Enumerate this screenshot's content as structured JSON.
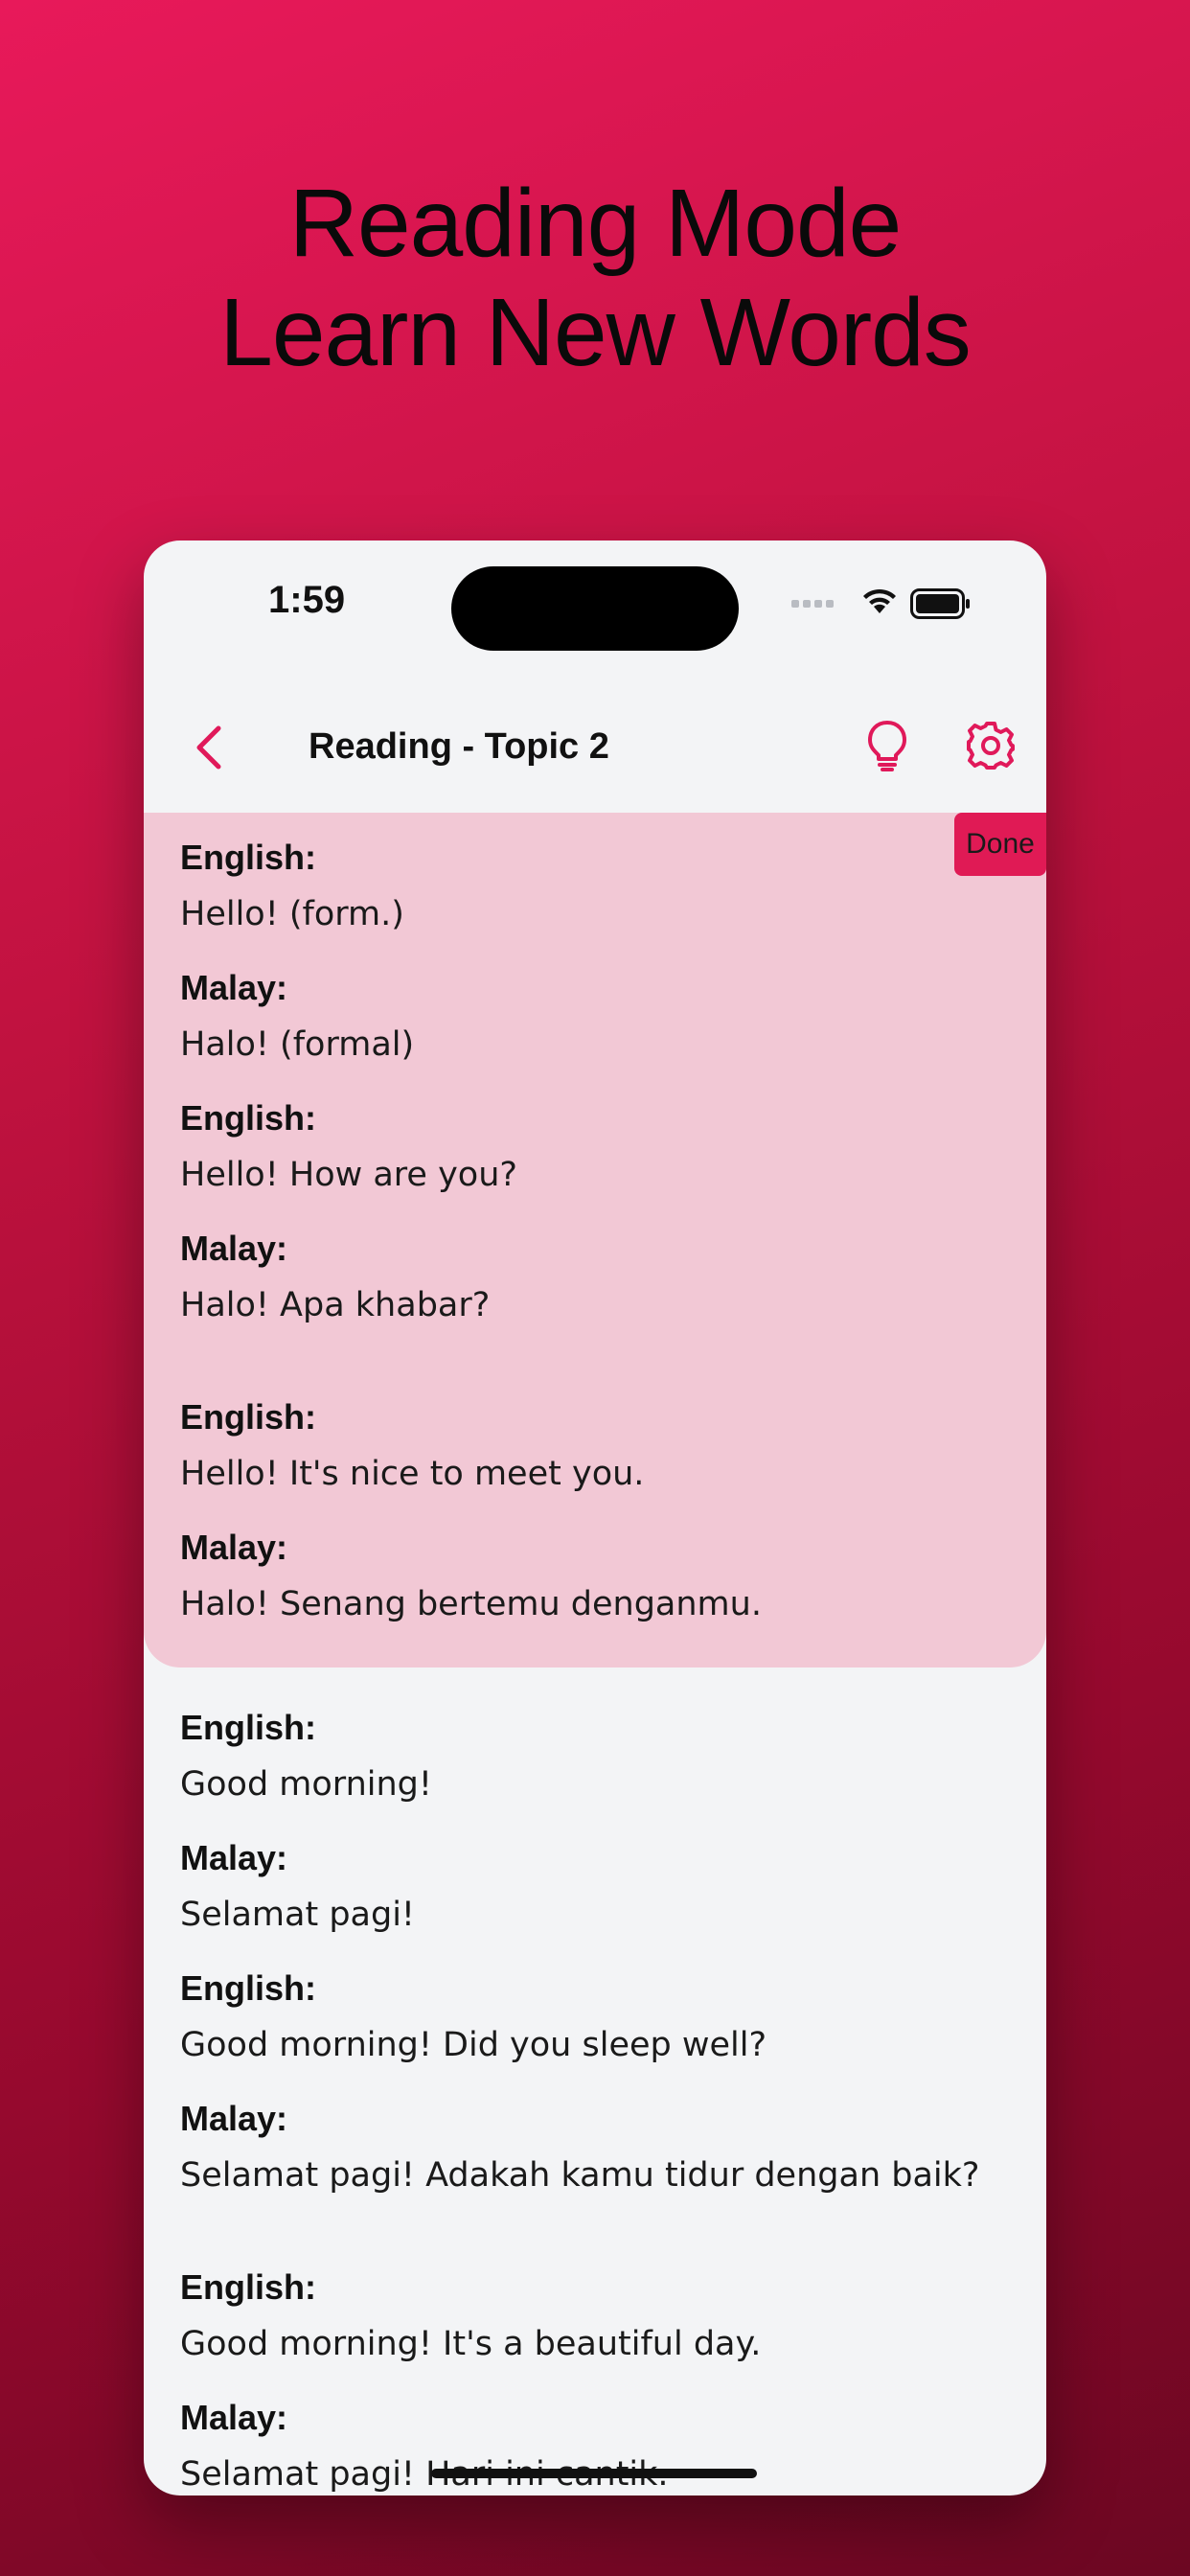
{
  "headline": {
    "line1": "Reading Mode",
    "line2": "Learn New Words"
  },
  "status_bar": {
    "time": "1:59"
  },
  "nav": {
    "title": "Reading - Topic 2",
    "accent_color": "#e0195a"
  },
  "cards": [
    {
      "state": "done",
      "done_label": "Done",
      "pairs": [
        {
          "english_label": "English:",
          "english": "Hello! (form.)",
          "malay_label": "Malay:",
          "malay": "Halo! (formal)"
        },
        {
          "english_label": "English:",
          "english": "Hello! How are you?",
          "malay_label": "Malay:",
          "malay": "Halo! Apa khabar?"
        },
        {
          "english_label": "English:",
          "english": "Hello! It's nice to meet you.",
          "malay_label": "Malay:",
          "malay": "Halo! Senang bertemu denganmu."
        }
      ]
    },
    {
      "state": "pending",
      "pairs": [
        {
          "english_label": "English:",
          "english": "Good morning!",
          "malay_label": "Malay:",
          "malay": "Selamat pagi!"
        },
        {
          "english_label": "English:",
          "english": "Good morning! Did you sleep well?",
          "malay_label": "Malay:",
          "malay": "Selamat pagi! Adakah kamu tidur dengan baik?"
        },
        {
          "english_label": "English:",
          "english": "Good morning! It's a beautiful day.",
          "malay_label": "Malay:",
          "malay": "Selamat pagi! Hari ini cantik."
        }
      ]
    }
  ]
}
